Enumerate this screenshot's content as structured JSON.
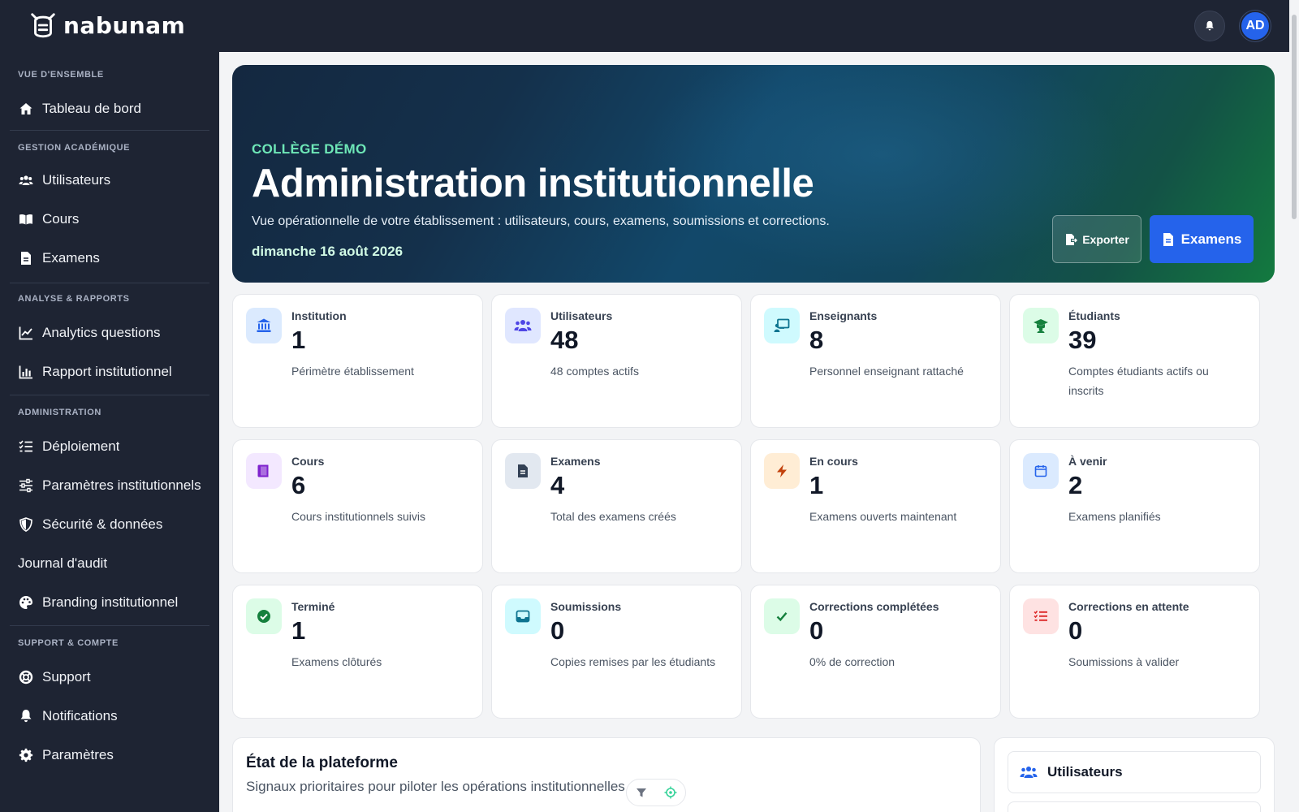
{
  "app": {
    "name": "nabunam",
    "avatar_initials": "AD"
  },
  "sidebar": {
    "sections": [
      {
        "title": "VUE D'ENSEMBLE"
      },
      {
        "title": "GESTION ACADÉMIQUE"
      },
      {
        "title": "ANALYSE & RAPPORTS"
      },
      {
        "title": "ADMINISTRATION"
      },
      {
        "title": "SUPPORT & COMPTE"
      }
    ],
    "items": [
      {
        "label": "Tableau de bord",
        "icon": "home-icon"
      },
      {
        "label": "Utilisateurs",
        "icon": "users-icon"
      },
      {
        "label": "Cours",
        "icon": "book-icon"
      },
      {
        "label": "Examens",
        "icon": "file-icon"
      },
      {
        "label": "Analytics questions",
        "icon": "line-chart-icon"
      },
      {
        "label": "Rapport institutionnel",
        "icon": "bar-chart-icon"
      },
      {
        "label": "Déploiement",
        "icon": "list-check-icon"
      },
      {
        "label": "Paramètres institutionnels",
        "icon": "sliders-icon"
      },
      {
        "label": "Sécurité & données",
        "icon": "shield-icon"
      },
      {
        "label": "Journal d'audit",
        "icon": ""
      },
      {
        "label": "Branding institutionnel",
        "icon": "palette-icon"
      },
      {
        "label": "Support",
        "icon": "lifebuoy-icon"
      },
      {
        "label": "Notifications",
        "icon": "bell-icon"
      },
      {
        "label": "Paramètres",
        "icon": "gear-icon"
      }
    ]
  },
  "hero": {
    "eyebrow": "COLLÈGE DÉMO",
    "title": "Administration institutionnelle",
    "subtitle": "Vue opérationnelle de votre établissement : utilisateurs, cours, examens, soumissions et corrections.",
    "date": "dimanche 16 août 2026",
    "export_label": "Exporter",
    "exams_label": "Examens"
  },
  "stats": [
    {
      "label": "Institution",
      "value": "1",
      "desc": "Périmètre établissement",
      "icon": "institution-icon",
      "color": "#2563eb",
      "bg": "#dbeafe"
    },
    {
      "label": "Utilisateurs",
      "value": "48",
      "desc": "48 comptes actifs",
      "icon": "users-icon",
      "color": "#4f46e5",
      "bg": "#e0e7ff"
    },
    {
      "label": "Enseignants",
      "value": "8",
      "desc": "Personnel enseignant rattaché",
      "icon": "teacher-icon",
      "color": "#0e7490",
      "bg": "#cffafe"
    },
    {
      "label": "Étudiants",
      "value": "39",
      "desc": "Comptes étudiants actifs ou inscrits",
      "icon": "graduation-icon",
      "color": "#15803d",
      "bg": "#dcfce7"
    },
    {
      "label": "Cours",
      "value": "6",
      "desc": "Cours institutionnels suivis",
      "icon": "book-icon",
      "color": "#7e22ce",
      "bg": "#f3e8ff"
    },
    {
      "label": "Examens",
      "value": "4",
      "desc": "Total des examens créés",
      "icon": "file-icon",
      "color": "#334155",
      "bg": "#e2e8f0"
    },
    {
      "label": "En cours",
      "value": "1",
      "desc": "Examens ouverts maintenant",
      "icon": "bolt-icon",
      "color": "#c2410c",
      "bg": "#ffedd5"
    },
    {
      "label": "À venir",
      "value": "2",
      "desc": "Examens planifiés",
      "icon": "calendar-icon",
      "color": "#2563eb",
      "bg": "#dbeafe"
    },
    {
      "label": "Terminé",
      "value": "1",
      "desc": "Examens clôturés",
      "icon": "check-circle-icon",
      "color": "#15803d",
      "bg": "#dcfce7"
    },
    {
      "label": "Soumissions",
      "value": "0",
      "desc": "Copies remises par les étudiants",
      "icon": "inbox-icon",
      "color": "#0e7490",
      "bg": "#cffafe"
    },
    {
      "label": "Corrections complétées",
      "value": "0",
      "desc": "0% de correction",
      "icon": "check-icon",
      "color": "#15803d",
      "bg": "#dcfce7"
    },
    {
      "label": "Corrections en attente",
      "value": "0",
      "desc": "Soumissions à valider",
      "icon": "list-icon",
      "color": "#dc2626",
      "bg": "#fee2e2"
    }
  ],
  "platform": {
    "title": "État de la plateforme",
    "subtitle": "Signaux prioritaires pour piloter les opérations institutionnelles"
  },
  "right_panel": {
    "item_label": "Utilisateurs"
  }
}
